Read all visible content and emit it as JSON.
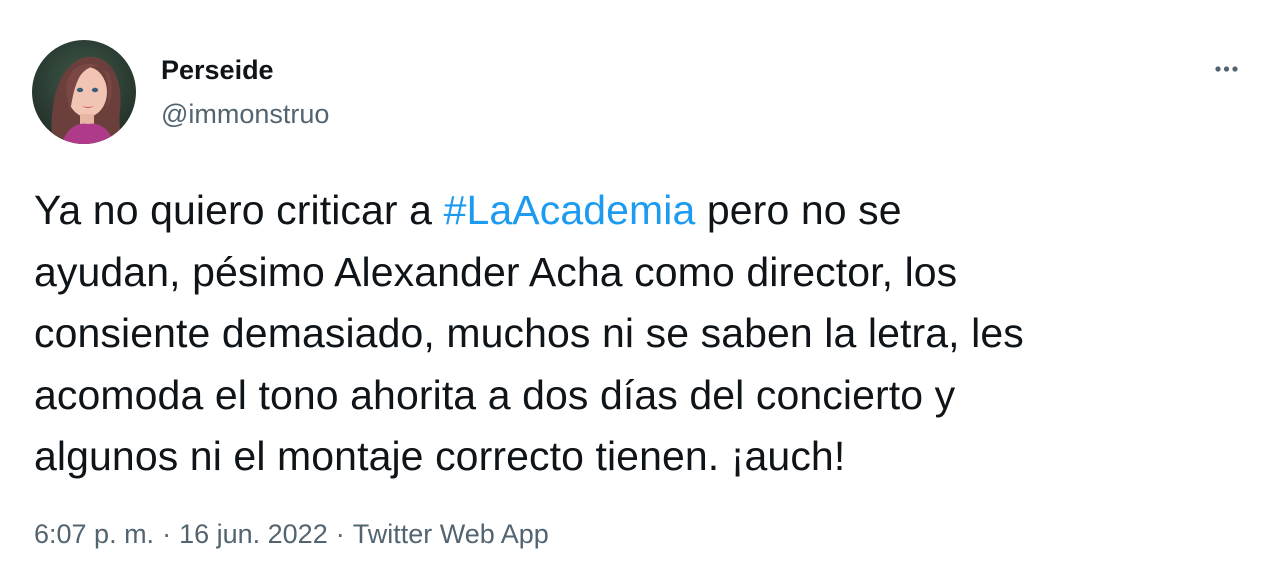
{
  "user": {
    "display_name": "Perseide",
    "handle": "@immonstruo"
  },
  "tweet": {
    "line1_before": "Ya no quiero criticar a ",
    "hashtag": "#LaAcademia",
    "line1_after": " pero no se",
    "line2": "ayudan, pésimo Alexander Acha como director, los",
    "line3": "consiente demasiado, muchos ni se saben la letra, les",
    "line4": "acomoda el tono ahorita a dos días del concierto y",
    "line5": "algunos ni el montaje correcto tienen. ¡auch!"
  },
  "meta": {
    "time": "6:07 p. m.",
    "separator": "·",
    "date": "16 jun. 2022",
    "source": "Twitter Web App"
  },
  "icons": {
    "more": "more-options-icon",
    "avatar": "profile-avatar"
  },
  "colors": {
    "text": "#0f1419",
    "secondary": "#536471",
    "link": "#1d9bf0",
    "background": "#ffffff"
  }
}
